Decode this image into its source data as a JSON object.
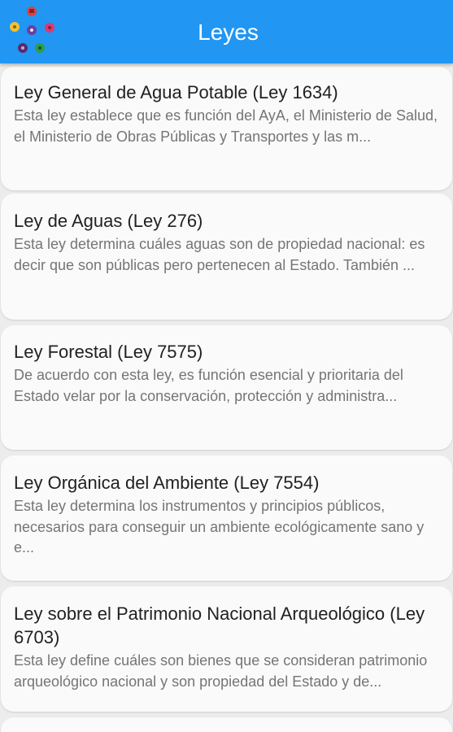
{
  "app": {
    "title": "Leyes",
    "logo": "app-logo-colored-circles",
    "accent_color": "#2196f3"
  },
  "laws": [
    {
      "title": "Ley General de Agua Potable (Ley 1634)",
      "description": "Esta ley establece que es función del AyA, el Ministerio de Salud, el Ministerio de Obras Públicas y Transportes y las m..."
    },
    {
      "title": "Ley de Aguas (Ley 276)",
      "description": "Esta ley determina cuáles aguas son de propiedad nacional: es decir que son públicas pero pertenecen al Estado. También ..."
    },
    {
      "title": "Ley Forestal (Ley 7575)",
      "description": "De acuerdo con esta ley, es función esencial y prioritaria del Estado velar por la conservación, protección y administra..."
    },
    {
      "title": "Ley Orgánica del Ambiente (Ley 7554)",
      "description": "Esta ley determina los instrumentos y principios públicos, necesarios para conseguir un ambiente ecológicamente sano y e..."
    },
    {
      "title": "Ley sobre el Patrimonio Nacional Arqueológico (Ley 6703)",
      "description": "Esta ley define cuáles son bienes que se consideran patrimonio arqueológico nacional y son propiedad del Estado y de..."
    }
  ]
}
